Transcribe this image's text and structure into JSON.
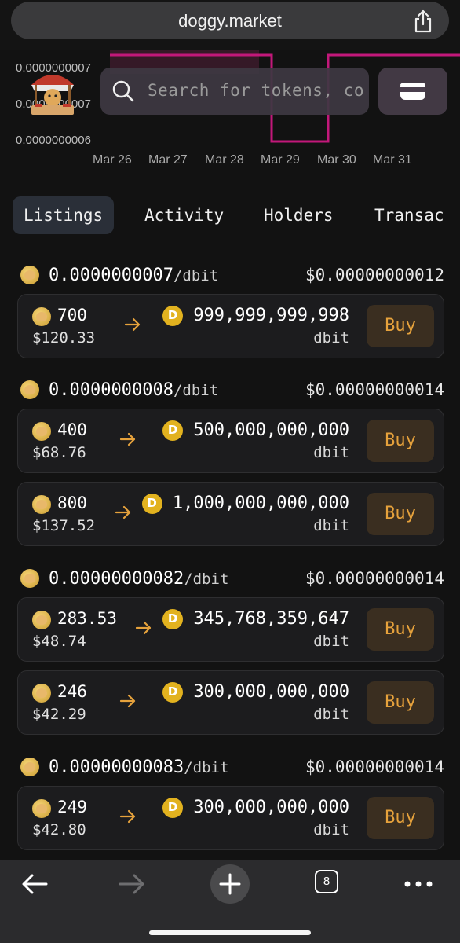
{
  "browser": {
    "url": "doggy.market",
    "tab_count": "8",
    "icons": [
      "share-icon",
      "back-arrow-icon",
      "forward-arrow-icon",
      "new-tab-plus-icon",
      "tabs-icon",
      "more-icon"
    ]
  },
  "chart_data": {
    "type": "line",
    "x": [
      "Mar 26",
      "Mar 27",
      "Mar 28",
      "Mar 29",
      "Mar 30",
      "Mar 31"
    ],
    "yticks": [
      "0.0000000007",
      "0.0000000007",
      "0.0000000006"
    ],
    "series": [
      {
        "color": "#c2187a",
        "values": [
          7e-10,
          7e-10,
          7e-10,
          6e-10,
          7e-10,
          7e-10
        ]
      }
    ],
    "grid": false
  },
  "search": {
    "placeholder": "Search for tokens, co"
  },
  "tabs": [
    "Listings",
    "Activity",
    "Holders",
    "Transac"
  ],
  "listings": [
    {
      "price": "0.0000000007",
      "unit": "/dbit",
      "usd": "$0.00000000012",
      "items": [
        {
          "amount": "700",
          "amount_usd": "$120.33",
          "tokens": "999,999,999,998",
          "token_unit": "dbit",
          "button": "Buy"
        }
      ]
    },
    {
      "price": "0.0000000008",
      "unit": "/dbit",
      "usd": "$0.00000000014",
      "items": [
        {
          "amount": "400",
          "amount_usd": "$68.76",
          "tokens": "500,000,000,000",
          "token_unit": "dbit",
          "button": "Buy"
        },
        {
          "amount": "800",
          "amount_usd": "$137.52",
          "tokens": "1,000,000,000,000",
          "token_unit": "dbit",
          "button": "Buy"
        }
      ]
    },
    {
      "price": "0.00000000082",
      "unit": "/dbit",
      "usd": "$0.00000000014",
      "items": [
        {
          "amount": "283.53",
          "amount_usd": "$48.74",
          "tokens": "345,768,359,647",
          "token_unit": "dbit",
          "button": "Buy"
        },
        {
          "amount": "246",
          "amount_usd": "$42.29",
          "tokens": "300,000,000,000",
          "token_unit": "dbit",
          "button": "Buy"
        }
      ]
    },
    {
      "price": "0.00000000083",
      "unit": "/dbit",
      "usd": "$0.00000000014",
      "items": [
        {
          "amount": "249",
          "amount_usd": "$42.80",
          "tokens": "300,000,000,000",
          "token_unit": "dbit",
          "button": "Buy"
        }
      ]
    }
  ],
  "colors": {
    "accent": "#e6a23c",
    "background": "#121212",
    "card": "#1c1c1e",
    "chart_line": "#c2187a"
  }
}
